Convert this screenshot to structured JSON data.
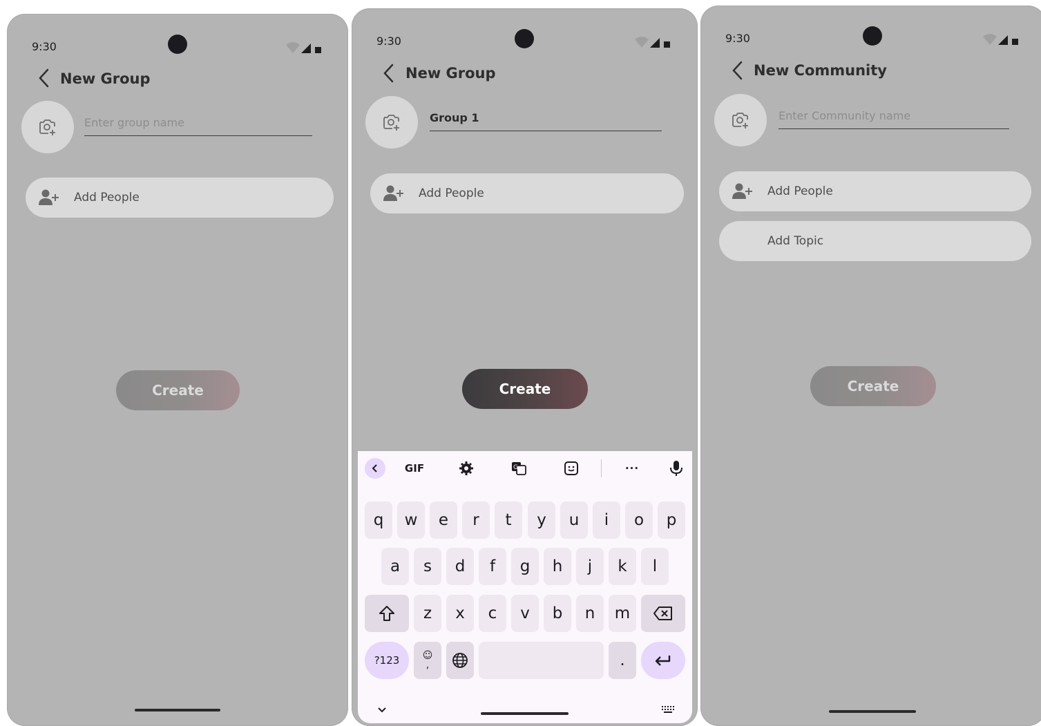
{
  "screens": [
    {
      "status_time": "9:30",
      "title": "New Group",
      "name_placeholder": "Enter group name",
      "name_value": "",
      "add_people_label": "Add People",
      "create_label": "Create",
      "create_state": "disabled"
    },
    {
      "status_time": "9:30",
      "title": "New Group",
      "name_placeholder": "Enter group name",
      "name_value": "Group 1",
      "add_people_label": "Add People",
      "create_label": "Create",
      "create_state": "enabled"
    },
    {
      "status_time": "9:30",
      "title": "New Community",
      "name_placeholder": "Enter Community name",
      "name_value": "",
      "add_people_label": "Add People",
      "add_topic_label": "Add Topic",
      "create_label": "Create",
      "create_state": "disabled"
    }
  ],
  "keyboard": {
    "toolbar": {
      "gif": "GIF",
      "icons": [
        "chevron-left-icon",
        "gear-icon",
        "translate-icon",
        "sticker-icon",
        "more-icon",
        "mic-icon"
      ]
    },
    "rows": [
      [
        "q",
        "w",
        "e",
        "r",
        "t",
        "y",
        "u",
        "i",
        "o",
        "p"
      ],
      [
        "a",
        "s",
        "d",
        "f",
        "g",
        "h",
        "j",
        "k",
        "l"
      ],
      [
        "z",
        "x",
        "c",
        "v",
        "b",
        "n",
        "m"
      ]
    ],
    "symbols_label": "?123",
    "emoji_label": "☺",
    "comma_label": ",",
    "period_label": "."
  },
  "colors": {
    "phone_bg": "#b4b4b4",
    "pill_bg": "#dadada",
    "keyboard_bg": "#fcf6fd",
    "accent": "#e6d7fb"
  }
}
